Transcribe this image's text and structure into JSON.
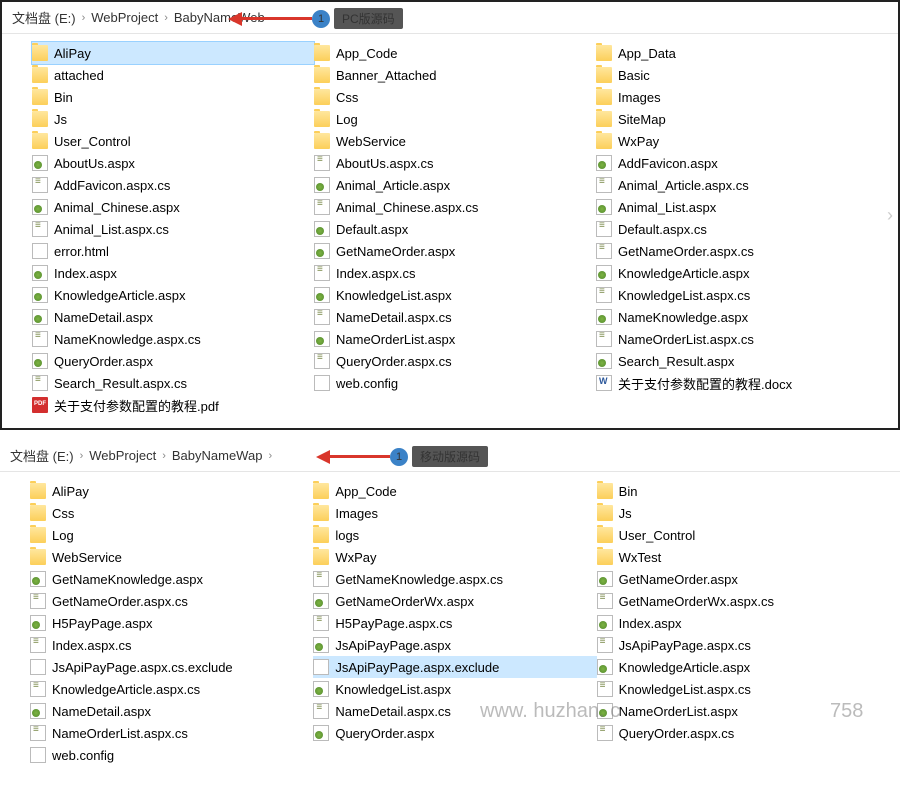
{
  "panel1": {
    "breadcrumb": [
      "文档盘 (E:)",
      "WebProject",
      "BabyNameWeb"
    ],
    "badge_num": "1",
    "badge_label": "PC版源码",
    "columns": [
      [
        {
          "t": "folder",
          "n": "AliPay",
          "sel": true
        },
        {
          "t": "folder",
          "n": "attached"
        },
        {
          "t": "folder",
          "n": "Bin"
        },
        {
          "t": "folder",
          "n": "Js"
        },
        {
          "t": "folder",
          "n": "User_Control"
        },
        {
          "t": "aspx",
          "n": "AboutUs.aspx"
        },
        {
          "t": "cs",
          "n": "AddFavicon.aspx.cs"
        },
        {
          "t": "aspx",
          "n": "Animal_Chinese.aspx"
        },
        {
          "t": "cs",
          "n": "Animal_List.aspx.cs"
        },
        {
          "t": "html",
          "n": "error.html"
        },
        {
          "t": "aspx",
          "n": "Index.aspx"
        },
        {
          "t": "aspx",
          "n": "KnowledgeArticle.aspx"
        },
        {
          "t": "aspx",
          "n": "NameDetail.aspx"
        },
        {
          "t": "cs",
          "n": "NameKnowledge.aspx.cs"
        },
        {
          "t": "aspx",
          "n": "QueryOrder.aspx"
        },
        {
          "t": "cs",
          "n": "Search_Result.aspx.cs"
        },
        {
          "t": "pdf",
          "n": "关于支付参数配置的教程.pdf"
        }
      ],
      [
        {
          "t": "folder",
          "n": "App_Code"
        },
        {
          "t": "folder",
          "n": "Banner_Attached"
        },
        {
          "t": "folder",
          "n": "Css"
        },
        {
          "t": "folder",
          "n": "Log"
        },
        {
          "t": "folder",
          "n": "WebService"
        },
        {
          "t": "cs",
          "n": "AboutUs.aspx.cs"
        },
        {
          "t": "aspx",
          "n": "Animal_Article.aspx"
        },
        {
          "t": "cs",
          "n": "Animal_Chinese.aspx.cs"
        },
        {
          "t": "aspx",
          "n": "Default.aspx"
        },
        {
          "t": "aspx",
          "n": "GetNameOrder.aspx"
        },
        {
          "t": "cs",
          "n": "Index.aspx.cs"
        },
        {
          "t": "aspx",
          "n": "KnowledgeList.aspx"
        },
        {
          "t": "cs",
          "n": "NameDetail.aspx.cs"
        },
        {
          "t": "aspx",
          "n": "NameOrderList.aspx"
        },
        {
          "t": "cs",
          "n": "QueryOrder.aspx.cs"
        },
        {
          "t": "blank",
          "n": "web.config"
        }
      ],
      [
        {
          "t": "folder",
          "n": "App_Data"
        },
        {
          "t": "folder",
          "n": "Basic"
        },
        {
          "t": "folder",
          "n": "Images"
        },
        {
          "t": "folder",
          "n": "SiteMap"
        },
        {
          "t": "folder",
          "n": "WxPay"
        },
        {
          "t": "aspx",
          "n": "AddFavicon.aspx"
        },
        {
          "t": "cs",
          "n": "Animal_Article.aspx.cs"
        },
        {
          "t": "aspx",
          "n": "Animal_List.aspx"
        },
        {
          "t": "cs",
          "n": "Default.aspx.cs"
        },
        {
          "t": "cs",
          "n": "GetNameOrder.aspx.cs"
        },
        {
          "t": "aspx",
          "n": "KnowledgeArticle.aspx"
        },
        {
          "t": "cs",
          "n": "KnowledgeList.aspx.cs"
        },
        {
          "t": "aspx",
          "n": "NameKnowledge.aspx"
        },
        {
          "t": "cs",
          "n": "NameOrderList.aspx.cs"
        },
        {
          "t": "aspx",
          "n": "Search_Result.aspx"
        },
        {
          "t": "docx",
          "n": "关于支付参数配置的教程.docx"
        }
      ]
    ]
  },
  "panel2": {
    "breadcrumb": [
      "文档盘 (E:)",
      "WebProject",
      "BabyNameWap"
    ],
    "badge_num": "1",
    "badge_label": "移动版源码",
    "columns": [
      [
        {
          "t": "folder",
          "n": "AliPay"
        },
        {
          "t": "folder",
          "n": "Css"
        },
        {
          "t": "folder",
          "n": "Log"
        },
        {
          "t": "folder",
          "n": "WebService"
        },
        {
          "t": "aspx",
          "n": "GetNameKnowledge.aspx"
        },
        {
          "t": "cs",
          "n": "GetNameOrder.aspx.cs"
        },
        {
          "t": "aspx",
          "n": "H5PayPage.aspx"
        },
        {
          "t": "cs",
          "n": "Index.aspx.cs"
        },
        {
          "t": "blank",
          "n": "JsApiPayPage.aspx.cs.exclude"
        },
        {
          "t": "cs",
          "n": "KnowledgeArticle.aspx.cs"
        },
        {
          "t": "aspx",
          "n": "NameDetail.aspx"
        },
        {
          "t": "cs",
          "n": "NameOrderList.aspx.cs"
        },
        {
          "t": "blank",
          "n": "web.config"
        }
      ],
      [
        {
          "t": "folder",
          "n": "App_Code"
        },
        {
          "t": "folder",
          "n": "Images"
        },
        {
          "t": "folder",
          "n": "logs"
        },
        {
          "t": "folder",
          "n": "WxPay"
        },
        {
          "t": "cs",
          "n": "GetNameKnowledge.aspx.cs"
        },
        {
          "t": "aspx",
          "n": "GetNameOrderWx.aspx"
        },
        {
          "t": "cs",
          "n": "H5PayPage.aspx.cs"
        },
        {
          "t": "aspx",
          "n": "JsApiPayPage.aspx"
        },
        {
          "t": "blank",
          "n": "JsApiPayPage.aspx.exclude",
          "hilite": true
        },
        {
          "t": "aspx",
          "n": "KnowledgeList.aspx"
        },
        {
          "t": "cs",
          "n": "NameDetail.aspx.cs"
        },
        {
          "t": "aspx",
          "n": "QueryOrder.aspx"
        }
      ],
      [
        {
          "t": "folder",
          "n": "Bin"
        },
        {
          "t": "folder",
          "n": "Js"
        },
        {
          "t": "folder",
          "n": "User_Control"
        },
        {
          "t": "folder",
          "n": "WxTest"
        },
        {
          "t": "aspx",
          "n": "GetNameOrder.aspx"
        },
        {
          "t": "cs",
          "n": "GetNameOrderWx.aspx.cs"
        },
        {
          "t": "aspx",
          "n": "Index.aspx"
        },
        {
          "t": "cs",
          "n": "JsApiPayPage.aspx.cs"
        },
        {
          "t": "aspx",
          "n": "KnowledgeArticle.aspx"
        },
        {
          "t": "cs",
          "n": "KnowledgeList.aspx.cs"
        },
        {
          "t": "aspx",
          "n": "NameOrderList.aspx"
        },
        {
          "t": "cs",
          "n": "QueryOrder.aspx.cs"
        }
      ]
    ]
  },
  "watermark1": "www. huzhan. c",
  "watermark2": "758"
}
